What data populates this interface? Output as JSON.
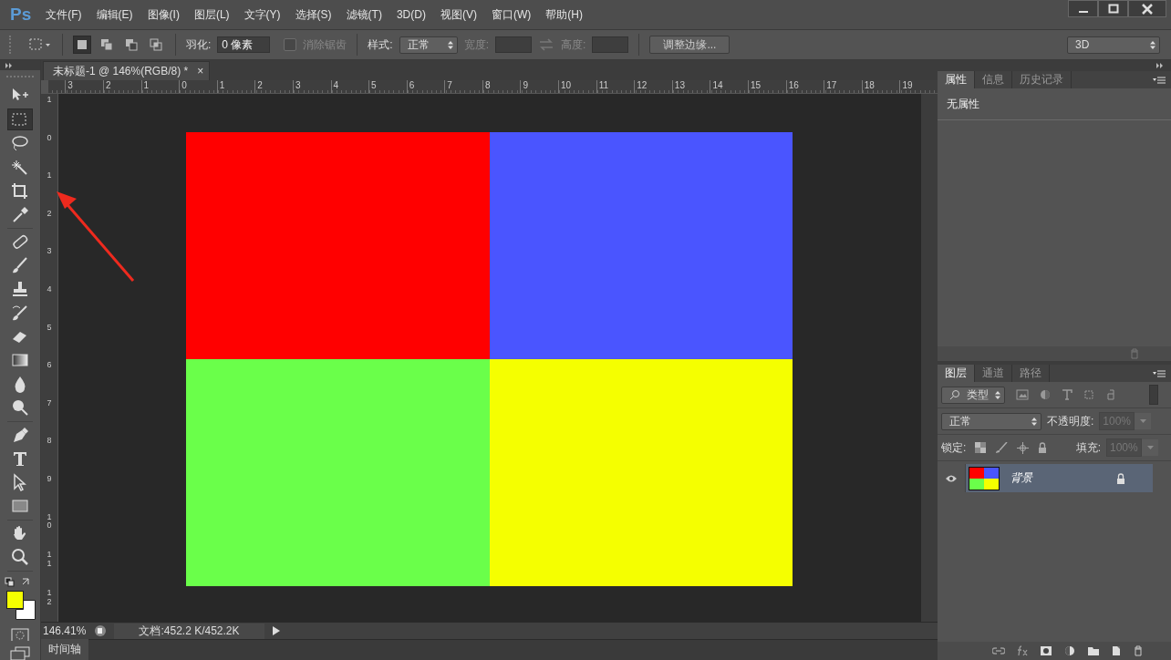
{
  "app": {
    "logo": "Ps"
  },
  "menu": [
    "文件(F)",
    "编辑(E)",
    "图像(I)",
    "图层(L)",
    "文字(Y)",
    "选择(S)",
    "滤镜(T)",
    "3D(D)",
    "视图(V)",
    "窗口(W)",
    "帮助(H)"
  ],
  "options_bar": {
    "modes": [
      {
        "kind": "new",
        "selected": true
      },
      {
        "kind": "add",
        "selected": false
      },
      {
        "kind": "subtract",
        "selected": false
      },
      {
        "kind": "intersect",
        "selected": false
      }
    ],
    "feather_label": "羽化:",
    "feather_value": "0 像素",
    "antialias": {
      "label": "消除锯齿",
      "checked": false,
      "disabled": true
    },
    "style_label": "样式:",
    "style_value": "正常",
    "width_label": "宽度:",
    "height_label": "高度:",
    "refine_button": "调整边缘...",
    "workspace": "3D"
  },
  "document_tab": {
    "title": "未标题-1 @ 146%(RGB/8) *",
    "close": "×"
  },
  "top_ruler": [
    "3",
    "2",
    "1",
    "0",
    "1",
    "2",
    "3",
    "4",
    "5",
    "6",
    "7",
    "8",
    "9",
    "10",
    "11",
    "12",
    "13",
    "14",
    "15",
    "16",
    "17",
    "18",
    "19"
  ],
  "left_ruler": [
    "1",
    "0",
    "1",
    "2",
    "3",
    "4",
    "5",
    "6",
    "7",
    "8",
    "9",
    "10",
    "11",
    "12"
  ],
  "tool_groups": [
    [
      {
        "kind": "move",
        "selected": false
      },
      {
        "kind": "marquee",
        "selected": true
      },
      {
        "kind": "lasso",
        "selected": false
      },
      {
        "kind": "wand",
        "selected": false
      },
      {
        "kind": "crop",
        "selected": false
      },
      {
        "kind": "eyedropper",
        "selected": false
      }
    ],
    [
      {
        "kind": "healing",
        "selected": false
      },
      {
        "kind": "brush",
        "selected": false
      },
      {
        "kind": "stamp",
        "selected": false
      },
      {
        "kind": "history",
        "selected": false
      },
      {
        "kind": "eraser",
        "selected": false
      },
      {
        "kind": "gradient",
        "selected": false
      },
      {
        "kind": "blur",
        "selected": false
      },
      {
        "kind": "dodge",
        "selected": false
      }
    ],
    [
      {
        "kind": "pen",
        "selected": false
      },
      {
        "kind": "type",
        "selected": false
      },
      {
        "kind": "path",
        "selected": false
      },
      {
        "kind": "shape",
        "selected": false
      }
    ],
    [
      {
        "kind": "hand",
        "selected": false
      },
      {
        "kind": "zoom",
        "selected": false
      }
    ]
  ],
  "swatches": [
    {
      "kind": "foreground",
      "color": "#f5ff00"
    },
    {
      "kind": "background",
      "color": "#ffffff"
    }
  ],
  "canvas": {
    "quadrants": [
      {
        "color": "#ff0000"
      },
      {
        "color": "#4a55ff"
      },
      {
        "color": "#6aff4a"
      },
      {
        "color": "#f5ff00"
      }
    ]
  },
  "status_bar": {
    "zoom": "146.41%",
    "doc_info": "文档:452.2 K/452.2K"
  },
  "timeline_tab": "时间轴",
  "properties_panel": {
    "tabs": [
      {
        "label": "属性",
        "selected": true
      },
      {
        "label": "信息",
        "selected": false
      },
      {
        "label": "历史记录",
        "selected": false
      }
    ],
    "content": "无属性"
  },
  "layers_panel": {
    "tabs": [
      {
        "label": "图层",
        "selected": true
      },
      {
        "label": "通道",
        "selected": false
      },
      {
        "label": "路径",
        "selected": false
      }
    ],
    "filter": "类型",
    "blend_mode": "正常",
    "opacity_label": "不透明度:",
    "opacity": "100%",
    "lock_label": "锁定:",
    "fill_label": "填充:",
    "fill": "100%",
    "layers": [
      {
        "name": "背景",
        "selected": true,
        "visible": true,
        "locked": true
      }
    ]
  }
}
